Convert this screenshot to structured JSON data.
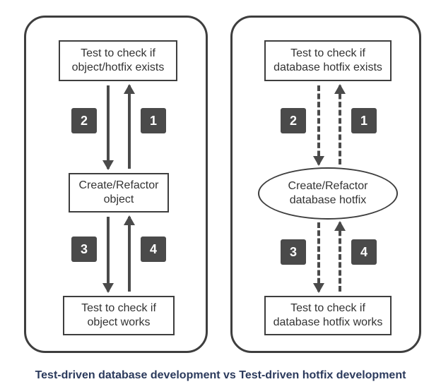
{
  "caption": "Test-driven database development vs Test-driven hotfix development",
  "left": {
    "top_box": "Test to check if\nobject/hotfix exists",
    "mid_box": "Create/Refactor\nobject",
    "bot_box": "Test to check if\nobject works",
    "badges": {
      "b1": "1",
      "b2": "2",
      "b3": "3",
      "b4": "4"
    }
  },
  "right": {
    "top_box": "Test to check if\ndatabase hotfix exists",
    "mid_box": "Create/Refactor\ndatabase hotfix",
    "bot_box": "Test to check if\ndatabase hotfix works",
    "badges": {
      "b1": "1",
      "b2": "2",
      "b3": "3",
      "b4": "4"
    }
  },
  "chart_data": {
    "type": "diagram",
    "title": "Test-driven database development vs Test-driven hotfix development",
    "panels": [
      {
        "name": "Test-driven database development",
        "arrow_style": "solid",
        "nodes": [
          {
            "id": "L1",
            "shape": "rect",
            "label": "Test to check if object/hotfix exists"
          },
          {
            "id": "L2",
            "shape": "rect",
            "label": "Create/Refactor object"
          },
          {
            "id": "L3",
            "shape": "rect",
            "label": "Test to check if object works"
          }
        ],
        "edges": [
          {
            "order": 1,
            "from": "L2",
            "to": "L1"
          },
          {
            "order": 2,
            "from": "L1",
            "to": "L2"
          },
          {
            "order": 3,
            "from": "L2",
            "to": "L3"
          },
          {
            "order": 4,
            "from": "L3",
            "to": "L2"
          }
        ]
      },
      {
        "name": "Test-driven hotfix development",
        "arrow_style": "dashed",
        "nodes": [
          {
            "id": "R1",
            "shape": "rect",
            "label": "Test to check if database hotfix exists"
          },
          {
            "id": "R2",
            "shape": "ellipse",
            "label": "Create/Refactor database hotfix"
          },
          {
            "id": "R3",
            "shape": "rect",
            "label": "Test to check if database hotfix works"
          }
        ],
        "edges": [
          {
            "order": 1,
            "from": "R2",
            "to": "R1"
          },
          {
            "order": 2,
            "from": "R1",
            "to": "R2"
          },
          {
            "order": 3,
            "from": "R2",
            "to": "R3"
          },
          {
            "order": 4,
            "from": "R3",
            "to": "R2"
          }
        ]
      }
    ]
  }
}
